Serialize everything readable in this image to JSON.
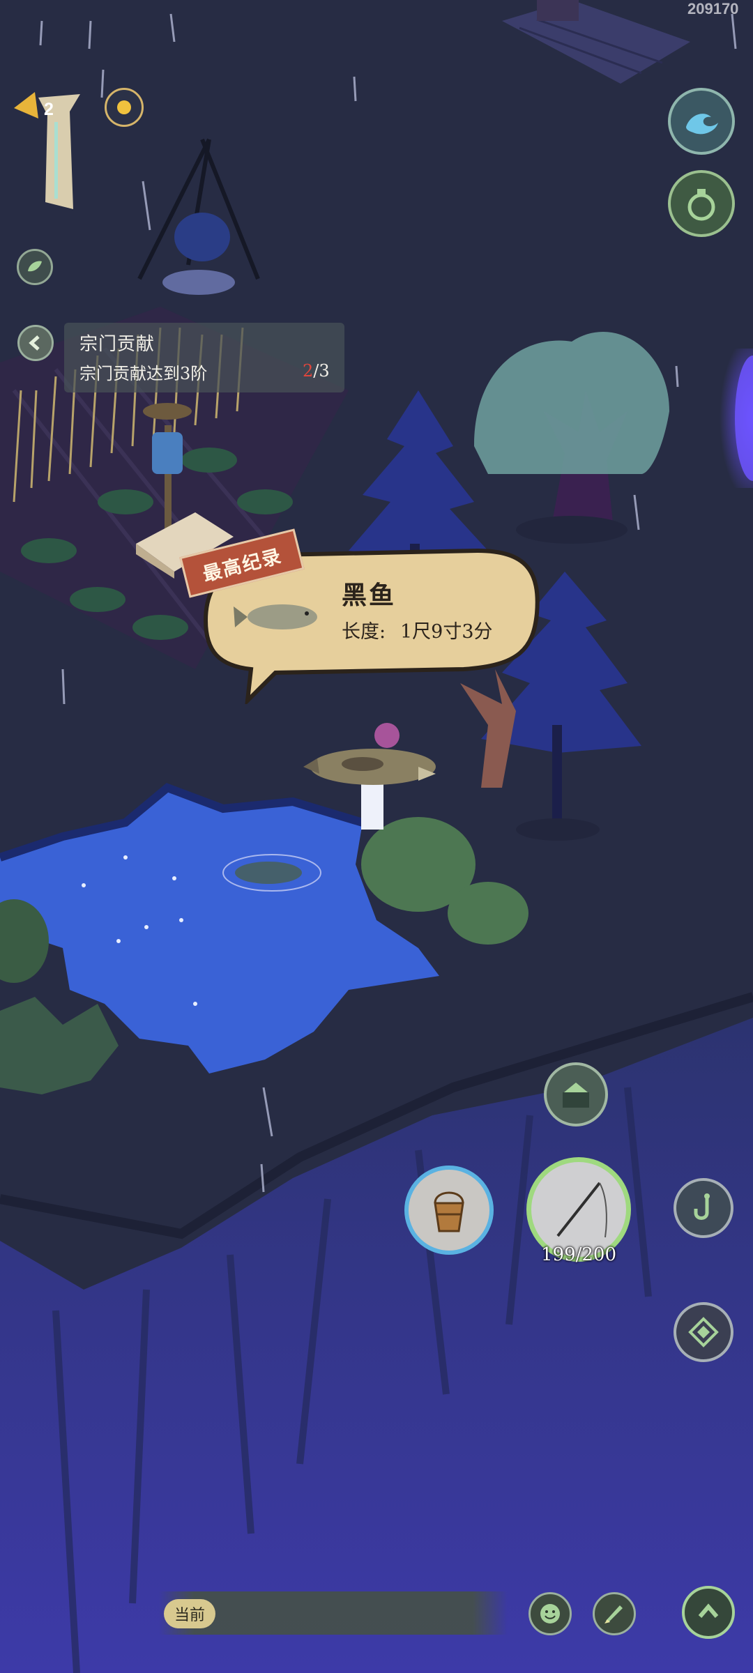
{
  "counter": "209170",
  "player": {
    "level": "2"
  },
  "quest": {
    "title": "宗门贡献",
    "description": "宗门贡献达到3阶",
    "progress_current": "2",
    "progress_total": "/3"
  },
  "catch_record": {
    "badge": "最高纪录",
    "fish_name": "黑鱼",
    "length_label": "长度:",
    "length_value": "1尺9寸3分"
  },
  "fishing": {
    "rod_durability": "199/200",
    "bait_icon": "bucket-icon"
  },
  "chat": {
    "channel": "当前"
  },
  "colors": {
    "water": "#3a62d6",
    "night_sky": "#262b45",
    "parchment": "#e6cf9c",
    "record_red": "#b4523a",
    "accent_green": "#a7d39a"
  }
}
